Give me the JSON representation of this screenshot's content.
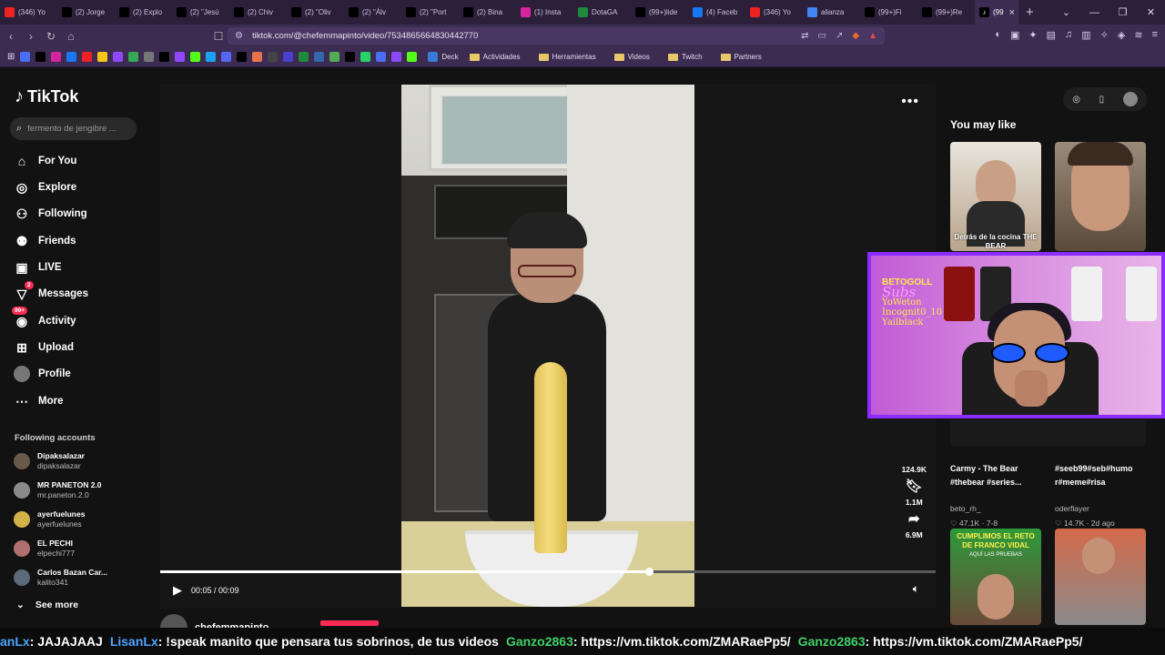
{
  "browser": {
    "tabs": [
      {
        "label": "(346) Yo",
        "color": "#e22"
      },
      {
        "label": "(2) Jorge",
        "color": "#000"
      },
      {
        "label": "(2) Explo",
        "color": "#000"
      },
      {
        "label": "(2) \"Jesú",
        "color": "#000"
      },
      {
        "label": "(2) Chiv",
        "color": "#000"
      },
      {
        "label": "(2) \"Oliv",
        "color": "#000"
      },
      {
        "label": "(2) \"Álv",
        "color": "#000"
      },
      {
        "label": "(2) \"Port",
        "color": "#000"
      },
      {
        "label": "(2) Bina",
        "color": "#000"
      },
      {
        "label": "(1) Insta",
        "color": "#d6249f"
      },
      {
        "label": "DotaGA",
        "color": "#1e8a3a"
      },
      {
        "label": "(99+)lide",
        "color": "#000"
      },
      {
        "label": "(4) Faceb",
        "color": "#1877f2"
      },
      {
        "label": "(346) Yo",
        "color": "#e22"
      },
      {
        "label": "alianza",
        "color": "#4285f4"
      },
      {
        "label": "(99+)Fi",
        "color": "#000"
      },
      {
        "label": "(99+)Re",
        "color": "#000"
      }
    ],
    "active_tab": {
      "label": "(99",
      "color": "#000"
    },
    "new_tab": "+",
    "url": "tiktok.com/@chefemmapinto/video/7534865664830442770",
    "bookmarks": {
      "deck": "Deck",
      "folders": [
        "Actividades",
        "Herramientas",
        "Videos",
        "Twitch",
        "Partners"
      ]
    }
  },
  "sidebar": {
    "logo": "TikTok",
    "search_placeholder": "fermento de jengibre ...",
    "nav": [
      {
        "label": "For You",
        "icon": "home-icon"
      },
      {
        "label": "Explore",
        "icon": "compass-icon"
      },
      {
        "label": "Following",
        "icon": "following-icon"
      },
      {
        "label": "Friends",
        "icon": "friends-icon"
      },
      {
        "label": "LIVE",
        "icon": "live-icon"
      },
      {
        "label": "Messages",
        "icon": "messages-icon",
        "badge": "2"
      },
      {
        "label": "Activity",
        "icon": "activity-icon",
        "badge": "99+"
      },
      {
        "label": "Upload",
        "icon": "upload-icon"
      },
      {
        "label": "Profile",
        "icon": "profile-icon"
      },
      {
        "label": "More",
        "icon": "more-icon"
      }
    ],
    "following_title": "Following accounts",
    "accounts": [
      {
        "name": "Dipaksalazar",
        "handle": "dipaksalazar",
        "color": "#6a5a4a"
      },
      {
        "name": "MR PANETON 2.0",
        "handle": "mr.paneton.2.0",
        "color": "#8a8a8a"
      },
      {
        "name": "ayerfuelunes",
        "handle": "ayerfuelunes",
        "color": "#d4b24a"
      },
      {
        "name": "EL PECHI",
        "handle": "elpechi777",
        "color": "#b07070"
      },
      {
        "name": "Carlos Bazan Car...",
        "handle": "kalito341",
        "color": "#5a6a7a"
      }
    ],
    "see_more": "See more"
  },
  "video": {
    "time": "00:05 / 00:09",
    "progress": 0.63,
    "stats": {
      "likes": "124.9K",
      "saves": "1.1M",
      "shares": "6.9M"
    },
    "author": "chefemmapinto"
  },
  "recommend": {
    "title": "You may like",
    "items": [
      {
        "caption": "Detrás de la cocina THE BEAR",
        "title": "Carmy - The Bear #thebear #series...",
        "author": "beto_rh_",
        "likes": "47.1K",
        "date": "7-8"
      },
      {
        "caption": "",
        "title": "#seeb99#seb#humo r#meme#risa",
        "author": "oderflayer",
        "likes": "14.7K",
        "date": "2d ago"
      },
      {
        "caption": "CUMPLIMOS EL RETO DE FRANCO VIDAL",
        "subcaption": "AQUÍ LAS PRUEBAS",
        "title": "",
        "author": "",
        "likes": "",
        "date": ""
      }
    ]
  },
  "webcam": {
    "brand": "BETOGOLL",
    "subs_label": "Subs",
    "subs": [
      "YoWeton",
      "Incognit0_10",
      "Yailblack"
    ]
  },
  "ticker": [
    {
      "user": "anLx",
      "text": ": JAJAJAAJ",
      "color": "#4ea3ff"
    },
    {
      "user": "LisanLx",
      "text": ": !speak manito que pensara tus sobrinos, de tus videos",
      "color": "#4ea3ff"
    },
    {
      "user": "Ganzo2863",
      "text": ": https://vm.tiktok.com/ZMARaePp5/",
      "color": "#3fd26a"
    },
    {
      "user": "Ganzo2863",
      "text": ": https://vm.tiktok.com/ZMARaePp5/",
      "color": "#3fd26a"
    }
  ]
}
